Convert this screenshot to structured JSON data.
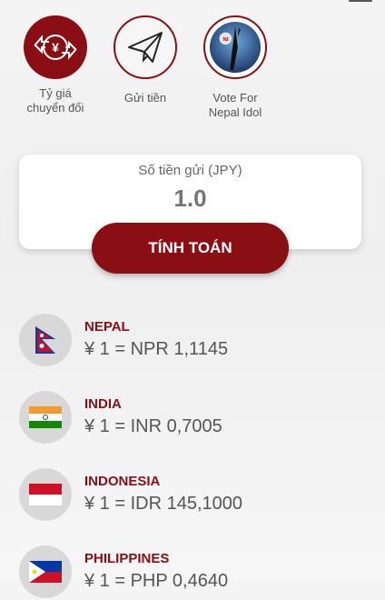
{
  "quick_actions": [
    {
      "label_line1": "Tỷ giá",
      "label_line2": "chuyển đổi",
      "icon": "currency-exchange-icon"
    },
    {
      "label_line1": "Gửi tiền",
      "label_line2": "",
      "icon": "paper-plane-icon"
    },
    {
      "label_line1": "Vote For",
      "label_line2": "Nepal Idol",
      "icon": "nepal-idol-logo"
    }
  ],
  "amount_card": {
    "label": "Số tiền gửi (JPY)",
    "placeholder": "1.0"
  },
  "calculate_button": "TÍNH TOÁN",
  "rates": [
    {
      "country": "NEPAL",
      "rate": "¥ 1 = NPR 1,1145",
      "flag": "nepal-flag"
    },
    {
      "country": "INDIA",
      "rate": "¥ 1 = INR 0,7005",
      "flag": "india-flag"
    },
    {
      "country": "INDONESIA",
      "rate": "¥ 1 = IDR 145,1000",
      "flag": "indonesia-flag"
    },
    {
      "country": "PHILIPPINES",
      "rate": "¥ 1 = PHP 0,4640",
      "flag": "philippines-flag"
    }
  ],
  "colors": {
    "accent": "#8a0f14",
    "background": "#f2f2f2"
  }
}
